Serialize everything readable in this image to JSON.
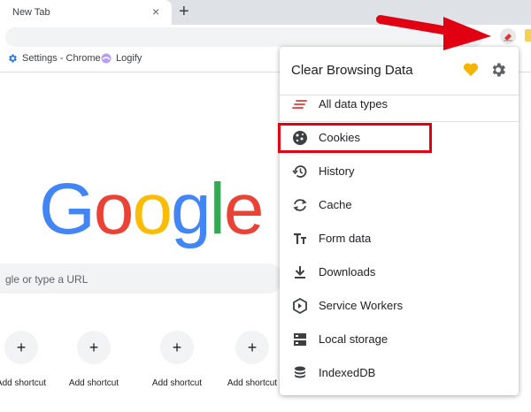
{
  "browser": {
    "tab_title": "New Tab",
    "tab_close": "×",
    "new_tab": "+",
    "bookmarks": [
      {
        "label": "Settings - Chrome"
      },
      {
        "label": "Logify"
      }
    ]
  },
  "ntp": {
    "logo_letters": [
      "G",
      "o",
      "o",
      "g",
      "l",
      "e"
    ],
    "logo_colors": [
      "#4285f4",
      "#ea4335",
      "#fbbc05",
      "#4285f4",
      "#34a853",
      "#ea4335"
    ],
    "search_placeholder": "gle or type a URL",
    "shortcut_icon": "+",
    "shortcuts": [
      {
        "label": "Add shortcut"
      },
      {
        "label": "Add shortcut"
      },
      {
        "label": "Add shortcut"
      },
      {
        "label": "Add shortcut"
      }
    ]
  },
  "popup": {
    "title": "Clear Browsing Data",
    "accent": "#f4b400",
    "items": [
      {
        "label": "All data types",
        "icon": "lines-icon"
      },
      {
        "label": "Cookies",
        "icon": "cookie-icon"
      },
      {
        "label": "History",
        "icon": "history-icon"
      },
      {
        "label": "Cache",
        "icon": "cache-icon"
      },
      {
        "label": "Form data",
        "icon": "form-data-icon"
      },
      {
        "label": "Downloads",
        "icon": "download-icon"
      },
      {
        "label": "Service Workers",
        "icon": "service-workers-icon"
      },
      {
        "label": "Local storage",
        "icon": "local-storage-icon"
      },
      {
        "label": "IndexedDB",
        "icon": "database-icon"
      }
    ]
  },
  "annotation": {
    "arrow_color": "#e00012",
    "highlight_color": "#e00012"
  }
}
